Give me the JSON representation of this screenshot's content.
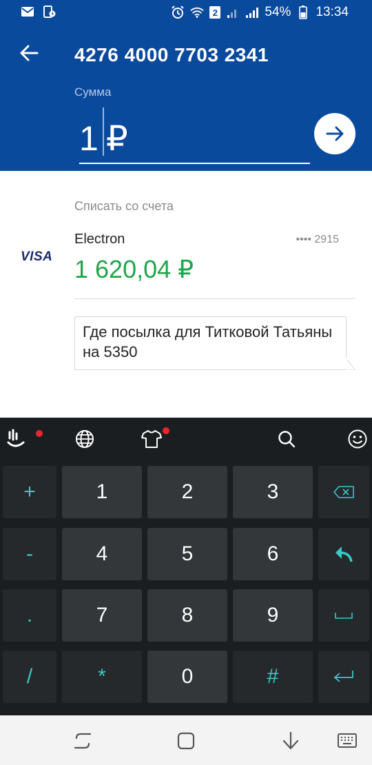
{
  "status_bar": {
    "battery": "54%",
    "time": "13:34",
    "sim_badge": "2"
  },
  "header": {
    "card_number": "4276 4000 7703 2341",
    "sum_label": "Сумма",
    "amount_value": "1",
    "currency": "₽"
  },
  "account": {
    "debit_label": "Списать со счета",
    "logo": "VISA",
    "name": "Electron",
    "mask": "•••• 2915",
    "balance": "1 620,04 ₽"
  },
  "comment": {
    "text": "Где посылка для Титковой Татьяны на 5350"
  },
  "keyboard": {
    "toolbar_icons": [
      "touchpal-logo-icon",
      "globe-icon",
      "tshirt-theme-icon",
      "search-icon",
      "smiley-icon"
    ],
    "rows": [
      {
        "side_left": "+",
        "keys": [
          "1",
          "2",
          "3"
        ],
        "side_right": "backspace-icon"
      },
      {
        "side_left": "-",
        "keys": [
          "4",
          "5",
          "6"
        ],
        "side_right": "reply-icon"
      },
      {
        "side_left": ".",
        "keys": [
          "7",
          "8",
          "9"
        ],
        "side_right": "space-icon"
      },
      {
        "side_left": "/",
        "keys": [
          "*",
          "0",
          "#"
        ],
        "side_right": "enter-icon"
      }
    ]
  },
  "colors": {
    "brand_blue": "#0a4a9c",
    "balance_green": "#1fa54a",
    "keyboard_accent": "#3cc7c7"
  }
}
